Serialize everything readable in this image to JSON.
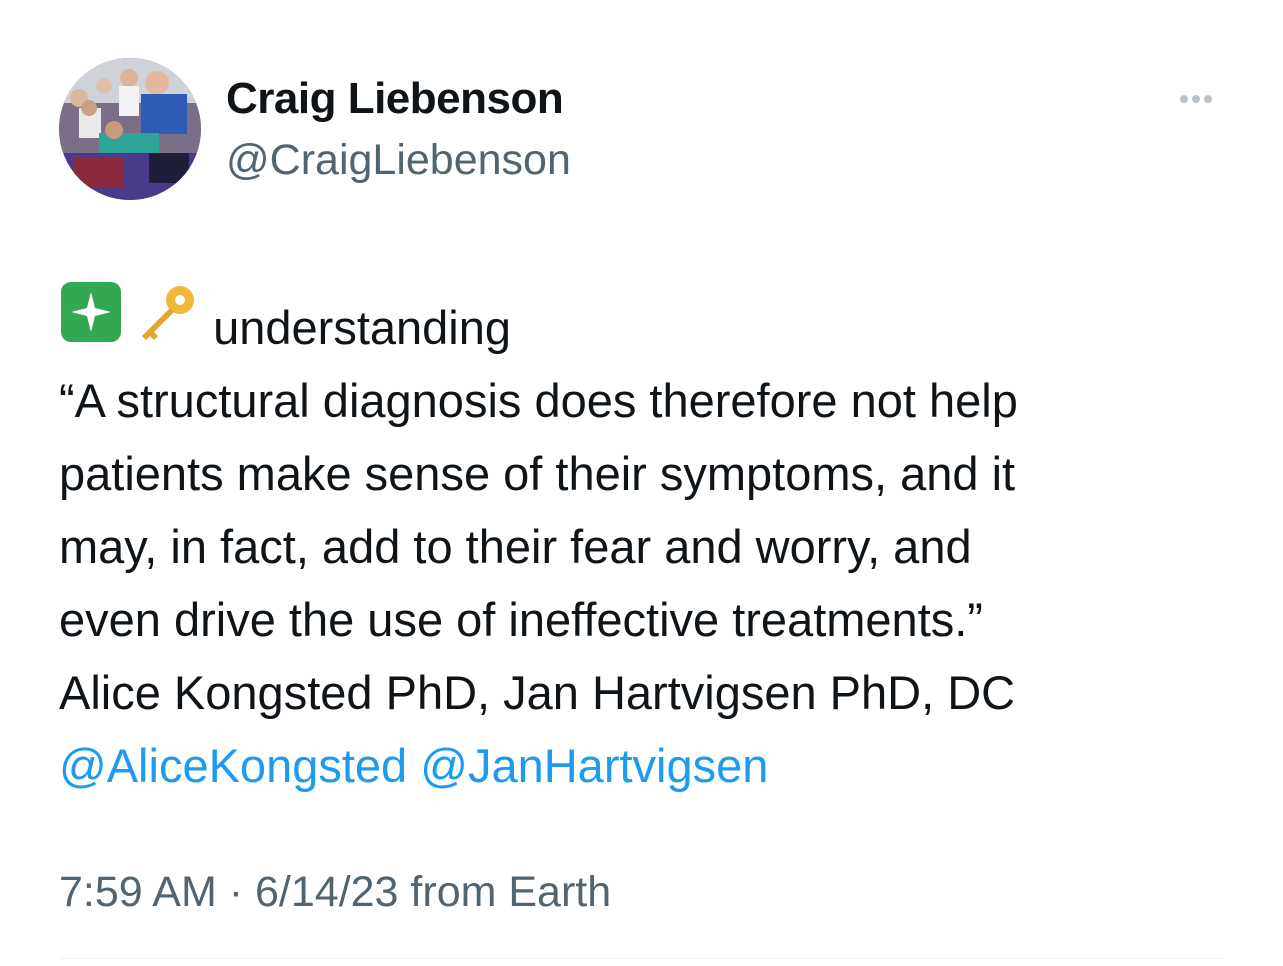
{
  "author": {
    "display_name": "Craig Liebenson",
    "handle": "@CraigLiebenson"
  },
  "tweet": {
    "lead_emojis": [
      "sparkles-icon",
      "key-icon"
    ],
    "lead_text": "understanding",
    "lines": [
      "“A structural diagnosis does therefore not help",
      "patients make sense of their symptoms, and it",
      "may, in fact, add to their fear and worry, and",
      "even drive the use of ineffective treatments.”",
      "Alice Kongsted PhD, Jan Hartvigsen PhD, DC"
    ],
    "mentions": [
      "@AliceKongsted",
      "@JanHartvigsen"
    ]
  },
  "meta": {
    "time": "7:59 AM",
    "separator": "·",
    "date": "6/14/23",
    "source": "from Earth"
  },
  "colors": {
    "text": "#0f1419",
    "secondary": "#536471",
    "link": "#1d9bf0",
    "sparkle_bg": "#33a852"
  }
}
